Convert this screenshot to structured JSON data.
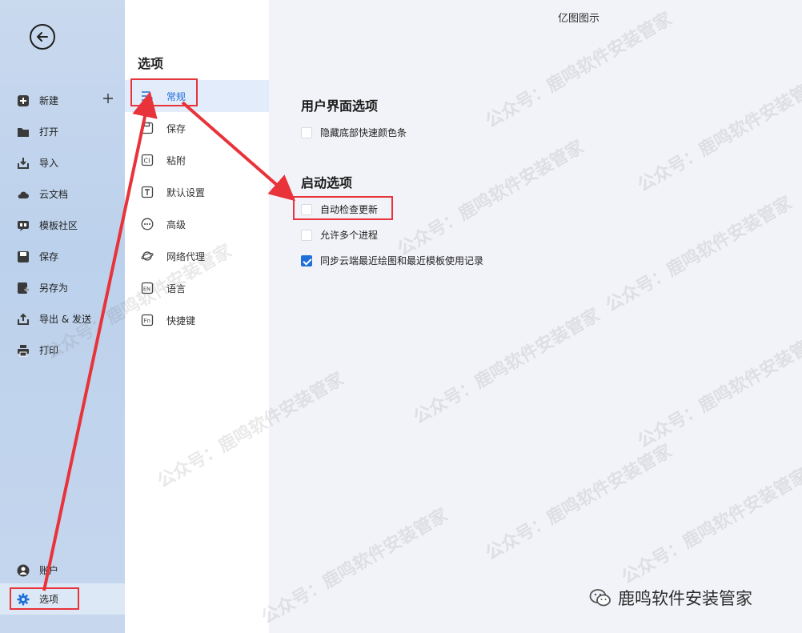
{
  "window": {
    "title": "亿图图示"
  },
  "sidebar": {
    "items": [
      {
        "label": "新建",
        "icon": "plus-square-icon"
      },
      {
        "label": "打开",
        "icon": "folder-icon"
      },
      {
        "label": "导入",
        "icon": "import-icon"
      },
      {
        "label": "云文档",
        "icon": "cloud-icon"
      },
      {
        "label": "模板社区",
        "icon": "template-icon"
      },
      {
        "label": "保存",
        "icon": "save-icon"
      },
      {
        "label": "另存为",
        "icon": "save-as-icon"
      },
      {
        "label": "导出 & 发送",
        "icon": "export-icon"
      },
      {
        "label": "打印",
        "icon": "print-icon"
      }
    ],
    "account_label": "账户",
    "options_label": "选项"
  },
  "options_nav": {
    "title": "选项",
    "items": [
      {
        "label": "常规",
        "icon": "general-settings-icon",
        "active": true
      },
      {
        "label": "保存",
        "icon": "save-icon"
      },
      {
        "label": "粘附",
        "icon": "snap-icon"
      },
      {
        "label": "默认设置",
        "icon": "text-icon"
      },
      {
        "label": "高级",
        "icon": "more-icon"
      },
      {
        "label": "网络代理",
        "icon": "network-icon"
      },
      {
        "label": "语言",
        "icon": "language-icon"
      },
      {
        "label": "快捷键",
        "icon": "shortcut-icon"
      }
    ]
  },
  "main": {
    "ui_section": {
      "title": "用户界面选项",
      "options": [
        {
          "label": "隐藏底部快速颜色条",
          "checked": false
        }
      ]
    },
    "startup_section": {
      "title": "启动选项",
      "options": [
        {
          "label": "自动检查更新",
          "checked": false
        },
        {
          "label": "允许多个进程",
          "checked": false
        },
        {
          "label": "同步云端最近绘图和最近模板使用记录",
          "checked": true
        }
      ]
    }
  },
  "watermark": {
    "text": "公众号：鹿鸣软件安装管家"
  },
  "brand": {
    "text": "鹿鸣软件安装管家"
  },
  "colors": {
    "accent": "#1e6fd9",
    "annotation": "#e8333a",
    "sidebar_bg": "#c9d9ee"
  }
}
